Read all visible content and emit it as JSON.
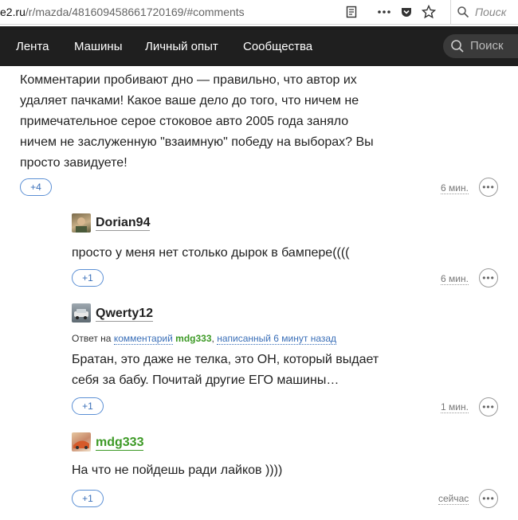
{
  "browser": {
    "url_host": "e2.ru",
    "url_path": "/r/mazda/481609458661720169/#comments",
    "search_placeholder": "Поиск",
    "icons": [
      "reader-icon",
      "more-icon",
      "pocket-icon",
      "bookmark-star-icon",
      "search-icon"
    ]
  },
  "nav": {
    "items": [
      "Лента",
      "Машины",
      "Личный опыт",
      "Сообщества"
    ],
    "search_label": "Поиск"
  },
  "comments": [
    {
      "text_lines": [
        "Комментарии пробивают дно — правильно, что автор их",
        "удаляет пачками! Какое ваше дело до того, что ничем не",
        "примечательное серое стоковое авто 2005 года заняло",
        "ничем не заслуженную \"взаимную\" победу на выборах? Вы",
        "просто завидуете!"
      ],
      "vote": "+4",
      "time": "6 мин."
    },
    {
      "author": "Dorian94",
      "text": "просто у меня нет столько дырок в бампере((((",
      "vote": "+1",
      "time": "6 мин."
    },
    {
      "author": "Qwerty12",
      "reply_prefix": "Ответ на",
      "reply_link": "комментарий",
      "reply_user": "mdg333",
      "reply_sep": ",",
      "reply_written": "написанный 6 минут назад",
      "text_lines": [
        "Братан, это даже не телка, это ОН, который выдает",
        "себя за бабу. Почитай другие ЕГО машины…"
      ],
      "vote": "+1",
      "time": "1 мин."
    },
    {
      "author": "mdg333",
      "text": "На что не пойдешь ради лайков ))))",
      "vote": "+1",
      "time": "сейчас"
    }
  ]
}
